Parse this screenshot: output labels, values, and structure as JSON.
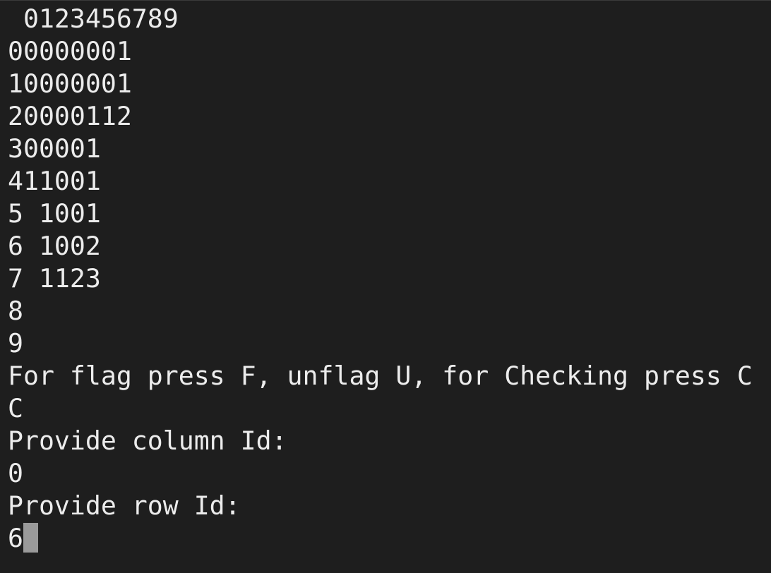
{
  "terminal": {
    "lines": [
      " 0123456789",
      "00000001",
      "10000001",
      "20000112",
      "300001",
      "411001",
      "5 1001",
      "6 1002",
      "7 1123",
      "8",
      "9",
      "For flag press F, unflag U, for Checking press C",
      "C",
      "Provide column Id:",
      "0",
      "Provide row Id:"
    ],
    "current_input": "6"
  },
  "colors": {
    "background": "#1e1e1e",
    "foreground": "#ececec",
    "cursor": "#9a9a9a"
  }
}
